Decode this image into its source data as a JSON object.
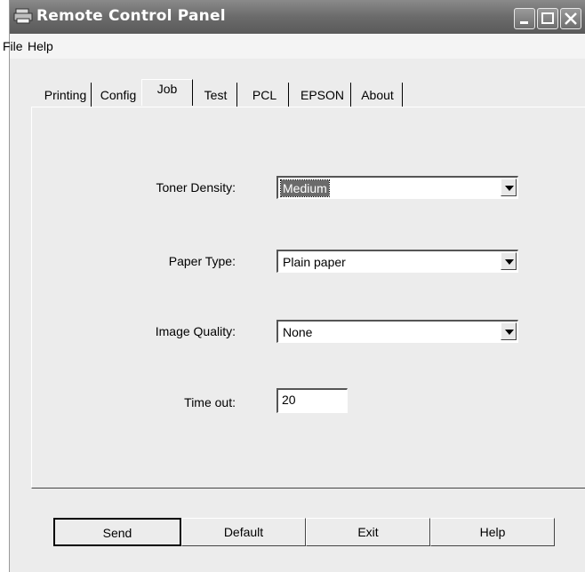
{
  "window": {
    "title": "Remote Control Panel",
    "icons": {
      "app": "printer-icon",
      "minimize": "minimize-icon",
      "maximize": "maximize-icon",
      "close": "close-icon"
    }
  },
  "menu": {
    "file": "File",
    "help": "Help"
  },
  "tabs": [
    "Printing",
    "Config",
    "Job",
    "Test",
    "PCL",
    "EPSON",
    "About"
  ],
  "active_tab": "Job",
  "job": {
    "toner_density": {
      "label": "Toner Density:",
      "value": "Medium"
    },
    "paper_type": {
      "label": "Paper Type:",
      "value": "Plain paper"
    },
    "image_quality": {
      "label": "Image Quality:",
      "value": "None"
    },
    "time_out": {
      "label": "Time out:",
      "value": "20"
    }
  },
  "buttons": {
    "send": "Send",
    "default": "Default",
    "exit": "Exit",
    "help": "Help"
  },
  "colors": {
    "titlebar": "#6b6b6b",
    "background": "#ececec",
    "selection": "#6b6b6b"
  }
}
